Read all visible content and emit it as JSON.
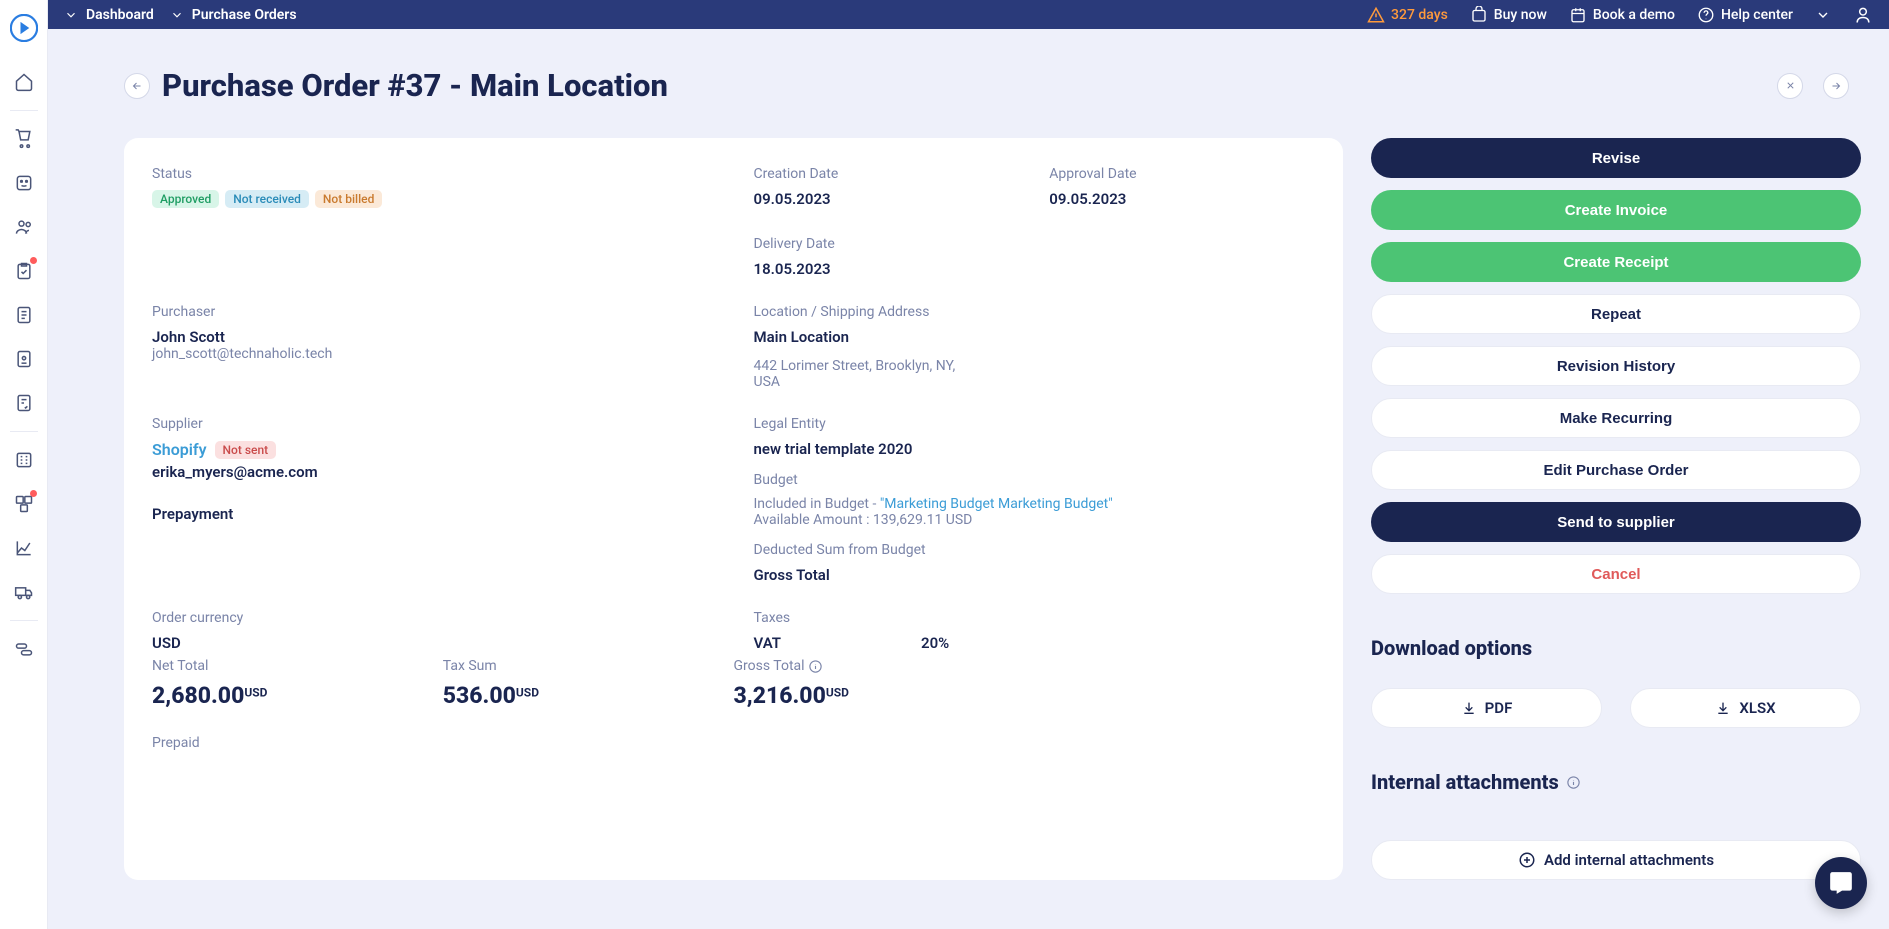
{
  "nav": {
    "breadcrumb1": "Dashboard",
    "breadcrumb2": "Purchase Orders"
  },
  "top": {
    "days": "327 days",
    "buy": "Buy now",
    "demo": "Book a demo",
    "help": "Help center"
  },
  "page": {
    "title": "Purchase Order #37 - Main Location"
  },
  "labels": {
    "status": "Status",
    "creation": "Creation Date",
    "approval": "Approval Date",
    "delivery": "Delivery Date",
    "purchaser": "Purchaser",
    "location": "Location / Shipping Address",
    "supplier": "Supplier",
    "legal": "Legal Entity",
    "budget": "Budget",
    "deducted": "Deducted Sum from Budget",
    "currency": "Order currency",
    "taxes": "Taxes",
    "net": "Net Total",
    "taxsum": "Tax Sum",
    "gross": "Gross Total",
    "prepaid": "Prepaid"
  },
  "status": {
    "approved": "Approved",
    "notreceived": "Not received",
    "notbilled": "Not billed",
    "notsent": "Not sent"
  },
  "values": {
    "creation": "09.05.2023",
    "approval": "09.05.2023",
    "delivery": "18.05.2023",
    "purchaser_name": "John Scott",
    "purchaser_email": "john_scott@technaholic.tech",
    "location_name": "Main Location",
    "location_addr": "442 Lorimer Street, Brooklyn, NY, USA",
    "supplier_name": "Shopify",
    "supplier_email": "erika_myers@acme.com",
    "prepayment": "Prepayment",
    "legal": "new trial template 2020",
    "budget_prefix": "Included in Budget - ",
    "budget_link": "\"Marketing Budget Marketing Budget\"",
    "budget_avail": "Available Amount : 139,629.11 USD",
    "deducted": "Gross Total",
    "currency": "USD",
    "tax_name": "VAT",
    "tax_rate": "20%",
    "net": "2,680.00",
    "taxsum": "536.00",
    "gross": "3,216.00",
    "cur": "USD"
  },
  "actions": {
    "revise": "Revise",
    "invoice": "Create Invoice",
    "receipt": "Create Receipt",
    "repeat": "Repeat",
    "history": "Revision History",
    "recurring": "Make Recurring",
    "edit": "Edit Purchase Order",
    "send": "Send to supplier",
    "cancel": "Cancel"
  },
  "download": {
    "title": "Download options",
    "pdf": "PDF",
    "xlsx": "XLSX"
  },
  "attachments": {
    "title": "Internal attachments",
    "add": "Add internal attachments"
  }
}
